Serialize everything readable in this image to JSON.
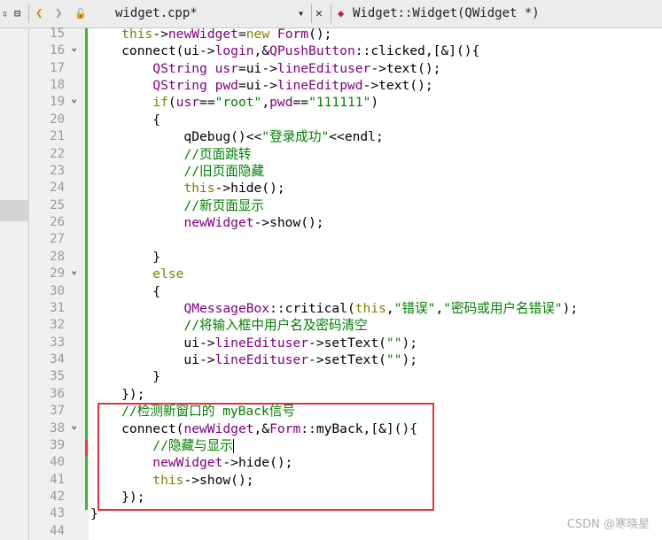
{
  "toolbar": {
    "split_icon": "split-vertical-icon",
    "back_glyph": "❮",
    "forward_glyph": "❯",
    "lock_glyph": "🔓",
    "file_name": "widget.cpp*",
    "dropdown_glyph": "▾",
    "close_glyph": "✕",
    "symbol_icon_glyph": "◆",
    "symbol_icon_color": "#c2185b",
    "symbol_name": "Widget::Widget(QWidget *)"
  },
  "colors": {
    "keyword": "#808000",
    "type": "#800080",
    "string": "#008000",
    "comment": "#008000",
    "change_bar": "#3fb33f",
    "highlight_box": "#e5323b"
  },
  "editor": {
    "lines": [
      {
        "n": "15",
        "fold": false,
        "tokens": [
          [
            "    "
          ],
          [
            "this",
            "kw"
          ],
          [
            "->"
          ],
          [
            "newWidget",
            "ty"
          ],
          [
            "="
          ],
          [
            "new",
            "kw"
          ],
          [
            " "
          ],
          [
            "Form",
            "ty"
          ],
          [
            "();"
          ]
        ]
      },
      {
        "n": "16",
        "fold": true,
        "tokens": [
          [
            "    connect(ui->"
          ],
          [
            "login",
            "ty"
          ],
          [
            ",&"
          ],
          [
            "QPushButton",
            "ty"
          ],
          [
            "::clicked,[&](){"
          ]
        ]
      },
      {
        "n": "17",
        "fold": false,
        "tokens": [
          [
            "        "
          ],
          [
            "QString",
            "ty"
          ],
          [
            " "
          ],
          [
            "usr",
            "ty"
          ],
          [
            "=ui->"
          ],
          [
            "lineEdituser",
            "ty"
          ],
          [
            "->text();"
          ]
        ]
      },
      {
        "n": "18",
        "fold": false,
        "tokens": [
          [
            "        "
          ],
          [
            "QString",
            "ty"
          ],
          [
            " "
          ],
          [
            "pwd",
            "ty"
          ],
          [
            "=ui->"
          ],
          [
            "lineEditpwd",
            "ty"
          ],
          [
            "->text();"
          ]
        ]
      },
      {
        "n": "19",
        "fold": true,
        "tokens": [
          [
            "        "
          ],
          [
            "if",
            "kw"
          ],
          [
            "("
          ],
          [
            "usr",
            "ty"
          ],
          [
            "=="
          ],
          [
            "\"root\"",
            "str"
          ],
          [
            ","
          ],
          [
            "pwd",
            "ty"
          ],
          [
            "=="
          ],
          [
            "\"111111\"",
            "str"
          ],
          [
            ")"
          ]
        ]
      },
      {
        "n": "20",
        "fold": false,
        "tokens": [
          [
            "        {"
          ]
        ]
      },
      {
        "n": "21",
        "fold": false,
        "tokens": [
          [
            "            qDebug()<<"
          ],
          [
            "\"登录成功\"",
            "str"
          ],
          [
            "<<endl;"
          ]
        ]
      },
      {
        "n": "22",
        "fold": false,
        "tokens": [
          [
            "            "
          ],
          [
            "//页面跳转",
            "cm"
          ]
        ]
      },
      {
        "n": "23",
        "fold": false,
        "tokens": [
          [
            "            "
          ],
          [
            "//旧页面隐藏",
            "cm"
          ]
        ]
      },
      {
        "n": "24",
        "fold": false,
        "tokens": [
          [
            "            "
          ],
          [
            "this",
            "kw"
          ],
          [
            "->hide();"
          ]
        ]
      },
      {
        "n": "25",
        "fold": false,
        "tokens": [
          [
            "            "
          ],
          [
            "//新页面显示",
            "cm"
          ]
        ]
      },
      {
        "n": "26",
        "fold": false,
        "tokens": [
          [
            "            "
          ],
          [
            "newWidget",
            "ty"
          ],
          [
            "->show();"
          ]
        ]
      },
      {
        "n": "27",
        "fold": false,
        "tokens": [
          [
            ""
          ]
        ]
      },
      {
        "n": "28",
        "fold": false,
        "tokens": [
          [
            "        }"
          ]
        ]
      },
      {
        "n": "29",
        "fold": true,
        "tokens": [
          [
            "        "
          ],
          [
            "else",
            "kw"
          ]
        ]
      },
      {
        "n": "30",
        "fold": false,
        "tokens": [
          [
            "        {"
          ]
        ]
      },
      {
        "n": "31",
        "fold": false,
        "tokens": [
          [
            "            "
          ],
          [
            "QMessageBox",
            "ty"
          ],
          [
            "::critical("
          ],
          [
            "this",
            "kw"
          ],
          [
            ","
          ],
          [
            "\"错误\"",
            "str"
          ],
          [
            ","
          ],
          [
            "\"密码或用户名错误\"",
            "str"
          ],
          [
            ");"
          ]
        ]
      },
      {
        "n": "32",
        "fold": false,
        "tokens": [
          [
            "            "
          ],
          [
            "//将输入框中用户名及密码清空",
            "cm"
          ]
        ]
      },
      {
        "n": "33",
        "fold": false,
        "tokens": [
          [
            "            ui->"
          ],
          [
            "lineEdituser",
            "ty"
          ],
          [
            "->setText("
          ],
          [
            "\"\"",
            "str"
          ],
          [
            ");"
          ]
        ]
      },
      {
        "n": "34",
        "fold": false,
        "tokens": [
          [
            "            ui->"
          ],
          [
            "lineEdituser",
            "ty"
          ],
          [
            "->setText("
          ],
          [
            "\"\"",
            "str"
          ],
          [
            ");"
          ]
        ]
      },
      {
        "n": "35",
        "fold": false,
        "tokens": [
          [
            "        }"
          ]
        ]
      },
      {
        "n": "36",
        "fold": false,
        "tokens": [
          [
            "    });"
          ]
        ]
      },
      {
        "n": "37",
        "fold": false,
        "tokens": [
          [
            "    "
          ],
          [
            "//检测新窗口的 myBack信号",
            "cm"
          ]
        ]
      },
      {
        "n": "38",
        "fold": true,
        "tokens": [
          [
            "    connect("
          ],
          [
            "newWidget",
            "ty"
          ],
          [
            ",&"
          ],
          [
            "Form",
            "ty"
          ],
          [
            "::myBack,[&](){"
          ]
        ]
      },
      {
        "n": "39",
        "fold": false,
        "cursor": true,
        "tokens": [
          [
            "        "
          ],
          [
            "//隐藏与显示",
            "cm"
          ]
        ]
      },
      {
        "n": "40",
        "fold": false,
        "tokens": [
          [
            "        "
          ],
          [
            "newWidget",
            "ty"
          ],
          [
            "->hide();"
          ]
        ]
      },
      {
        "n": "41",
        "fold": false,
        "tokens": [
          [
            "        "
          ],
          [
            "this",
            "kw"
          ],
          [
            "->show();"
          ]
        ]
      },
      {
        "n": "42",
        "fold": false,
        "tokens": [
          [
            "    });"
          ]
        ]
      },
      {
        "n": "43",
        "fold": false,
        "tokens": [
          [
            "}"
          ]
        ]
      },
      {
        "n": "44",
        "fold": false,
        "tokens": [
          [
            ""
          ]
        ]
      }
    ]
  },
  "watermark": "CSDN @寒晓星"
}
